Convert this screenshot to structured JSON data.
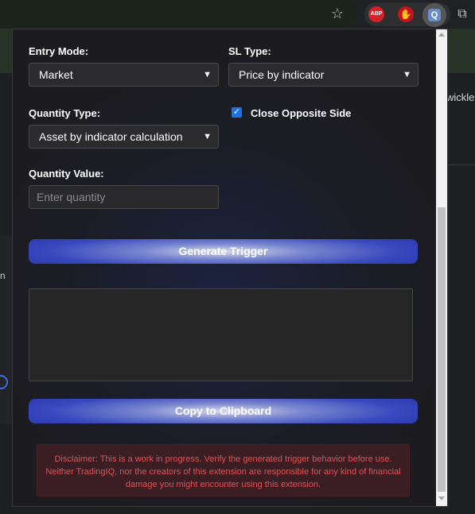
{
  "browser": {
    "bookmark_icon": "star-icon",
    "extensions": [
      {
        "name": "abp-icon",
        "label": "ABP"
      },
      {
        "name": "hand-icon",
        "label": "✋"
      },
      {
        "name": "tradingiq-icon",
        "label": "Q"
      }
    ],
    "puzzle_icon": "puzzle-icon"
  },
  "background_page": {
    "right_text": "wickle",
    "left_text": "n"
  },
  "form": {
    "entry_mode": {
      "label": "Entry Mode:",
      "value": "Market"
    },
    "sl_type": {
      "label": "SL Type:",
      "value": "Price by indicator"
    },
    "quantity_type": {
      "label": "Quantity Type:",
      "value": "Asset by indicator calculation"
    },
    "close_opposite": {
      "label": "Close Opposite Side",
      "checked": true
    },
    "quantity_value": {
      "label": "Quantity Value:",
      "placeholder": "Enter quantity"
    }
  },
  "buttons": {
    "generate": "Generate Trigger",
    "copy": "Copy to Clipboard"
  },
  "output": {
    "value": ""
  },
  "disclaimer": "Disclaimer: This is a work in progress. Verify the generated trigger behavior before use. Neither TradingIQ, nor the creators of this extension are responsible for any kind of financial damage you might encounter using this extension.",
  "colors": {
    "accent": "#3848bd",
    "disclaimer_text": "#e05252",
    "checkbox": "#1a73e8"
  }
}
